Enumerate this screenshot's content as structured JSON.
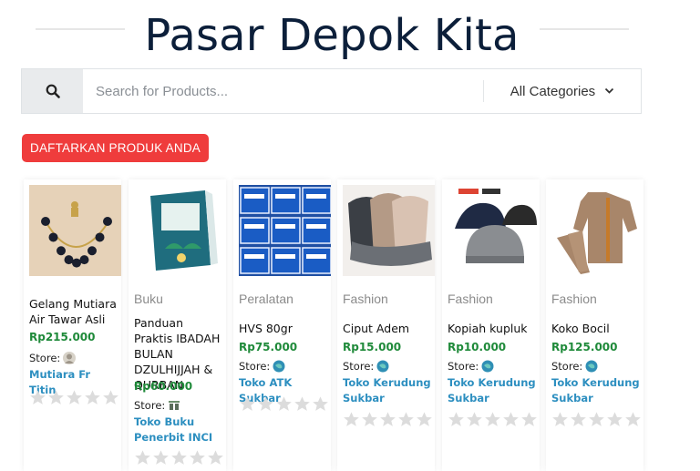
{
  "site": {
    "title": "Pasar Depok Kita"
  },
  "search": {
    "placeholder": "Search for Products...",
    "category": "All Categories"
  },
  "cta": {
    "label": "DAFTARKAN PRODUK ANDA"
  },
  "colors": {
    "accent_red": "#ef3c3c",
    "price_green": "#1f8a3a",
    "store_blue": "#2d8fc0",
    "title_navy": "#0c1f3a"
  },
  "store_label": "Store:",
  "products": [
    {
      "category": "",
      "name": "Gelang Mutiara Air Tawar Asli",
      "price": "Rp215.000",
      "store": "Mutiara Fr Titin",
      "image": "bracelet-image",
      "store_icon": "avatar-icon",
      "rating": 0
    },
    {
      "category": "Buku",
      "name": "Panduan Praktis IBADAH BULAN DZULHIJJAH & QURBAN",
      "price": "Rp60.000",
      "store": "Toko Buku Penerbit INCI",
      "image": "book-cover-image",
      "store_icon": "store-logo-icon",
      "rating": 0
    },
    {
      "category": "Peralatan",
      "name": "HVS 80gr",
      "price": "Rp75.000",
      "store": "Toko ATK Sukbar",
      "image": "paper-reams-image",
      "store_icon": "globe-icon",
      "rating": 0
    },
    {
      "category": "Fashion",
      "name": "Ciput Adem",
      "price": "Rp15.000",
      "store": "Toko Kerudung Sukbar",
      "image": "ciput-image",
      "store_icon": "globe-icon",
      "rating": 0
    },
    {
      "category": "Fashion",
      "name": "Kopiah kupluk",
      "price": "Rp10.000",
      "store": "Toko Kerudung Sukbar",
      "image": "kopiah-image",
      "store_icon": "globe-icon",
      "rating": 0
    },
    {
      "category": "Fashion",
      "name": "Koko Bocil",
      "price": "Rp125.000",
      "store": "Toko Kerudung Sukbar",
      "image": "koko-image",
      "store_icon": "globe-icon",
      "rating": 0
    }
  ]
}
